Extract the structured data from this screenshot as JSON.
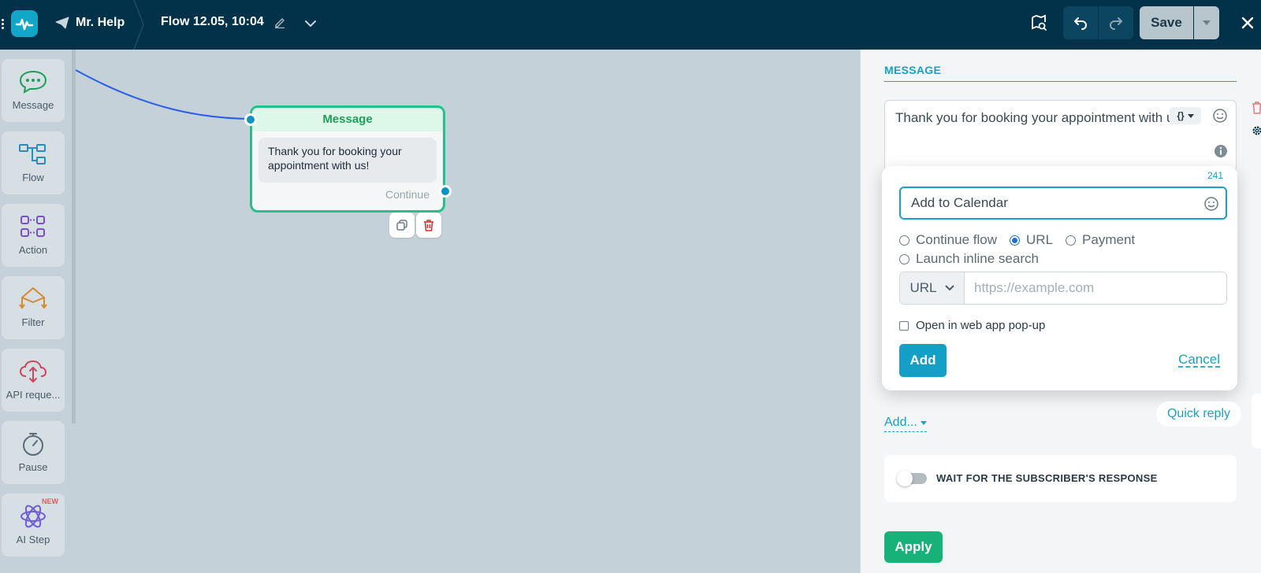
{
  "topbar": {
    "bot_name": "Mr. Help",
    "flow_title": "Flow 12.05, 10:04",
    "save_label": "Save"
  },
  "sidebar": {
    "items": [
      {
        "label": "Message",
        "icon": "message-bubble-icon",
        "color": "#1f9e5a"
      },
      {
        "label": "Flow",
        "icon": "flow-icon",
        "color": "#2d8bb6"
      },
      {
        "label": "Action",
        "icon": "action-icon",
        "color": "#7b4fc4"
      },
      {
        "label": "Filter",
        "icon": "filter-icon",
        "color": "#d88a2a"
      },
      {
        "label": "API reque...",
        "icon": "api-cloud-icon",
        "color": "#c9485c"
      },
      {
        "label": "Pause",
        "icon": "stopwatch-icon",
        "color": "#5a6c78"
      },
      {
        "label": "AI Step",
        "icon": "ai-atom-icon",
        "color": "#6f5bd8",
        "badge": "NEW"
      }
    ]
  },
  "node": {
    "title": "Message",
    "text": "Thank you for booking your appointment with us!",
    "continue_label": "Continue"
  },
  "panel": {
    "title": "MESSAGE",
    "message_text": "Thank you for booking your appointment with us!",
    "char_count": "241",
    "button_editor": {
      "button_text": "Add to Calendar",
      "options": [
        "Continue flow",
        "URL",
        "Payment",
        "Launch inline search"
      ],
      "selected": "URL",
      "url_type": "URL",
      "url_placeholder": "https://example.com",
      "checkbox_label": "Open in web app pop-up",
      "add_label": "Add",
      "cancel_label": "Cancel"
    },
    "add_menu_label": "Add...",
    "quick_reply_label": "Quick reply",
    "wait_label": "WAIT FOR THE SUBSCRIBER'S RESPONSE",
    "apply_label": "Apply"
  },
  "colors": {
    "topbar": "#023249",
    "accent": "#16a3c4",
    "node_border": "#27c08a",
    "apply": "#19b17a"
  }
}
